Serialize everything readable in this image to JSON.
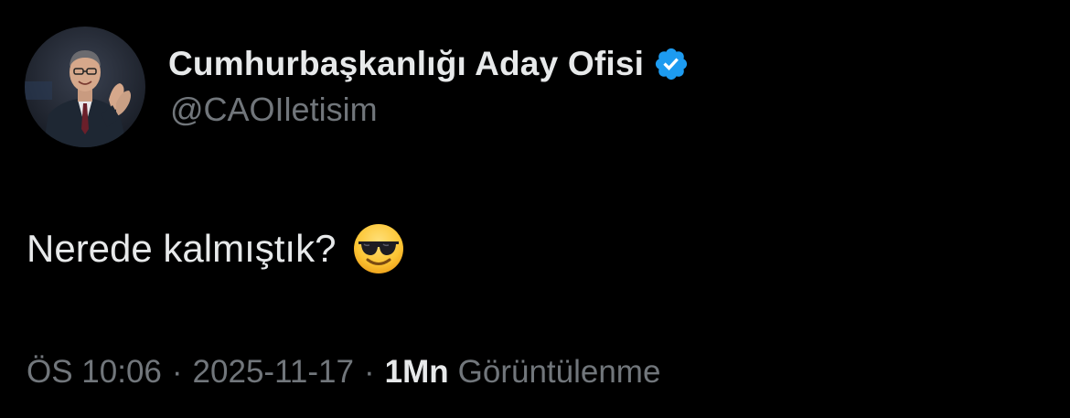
{
  "tweet": {
    "author": {
      "display_name": "Cumhurbaşkanlığı Aday Ofisi",
      "handle": "@CAOIletisim",
      "verified_badge_color": "#1d9bf0",
      "verified_icon": "verified-badge-icon",
      "avatar_icon": "profile-photo"
    },
    "text": "Nerede kalmıştık?",
    "emoji_icon": "smiling-face-with-sunglasses-emoji",
    "time": "ÖS 10:06",
    "separator": "·",
    "date": "2025-11-17",
    "views_count": "1Mn",
    "views_label": "Görüntülenme"
  },
  "colors": {
    "background": "#000000",
    "primary_text": "#e7e9ea",
    "secondary_text": "#71767b",
    "accent": "#1d9bf0"
  }
}
